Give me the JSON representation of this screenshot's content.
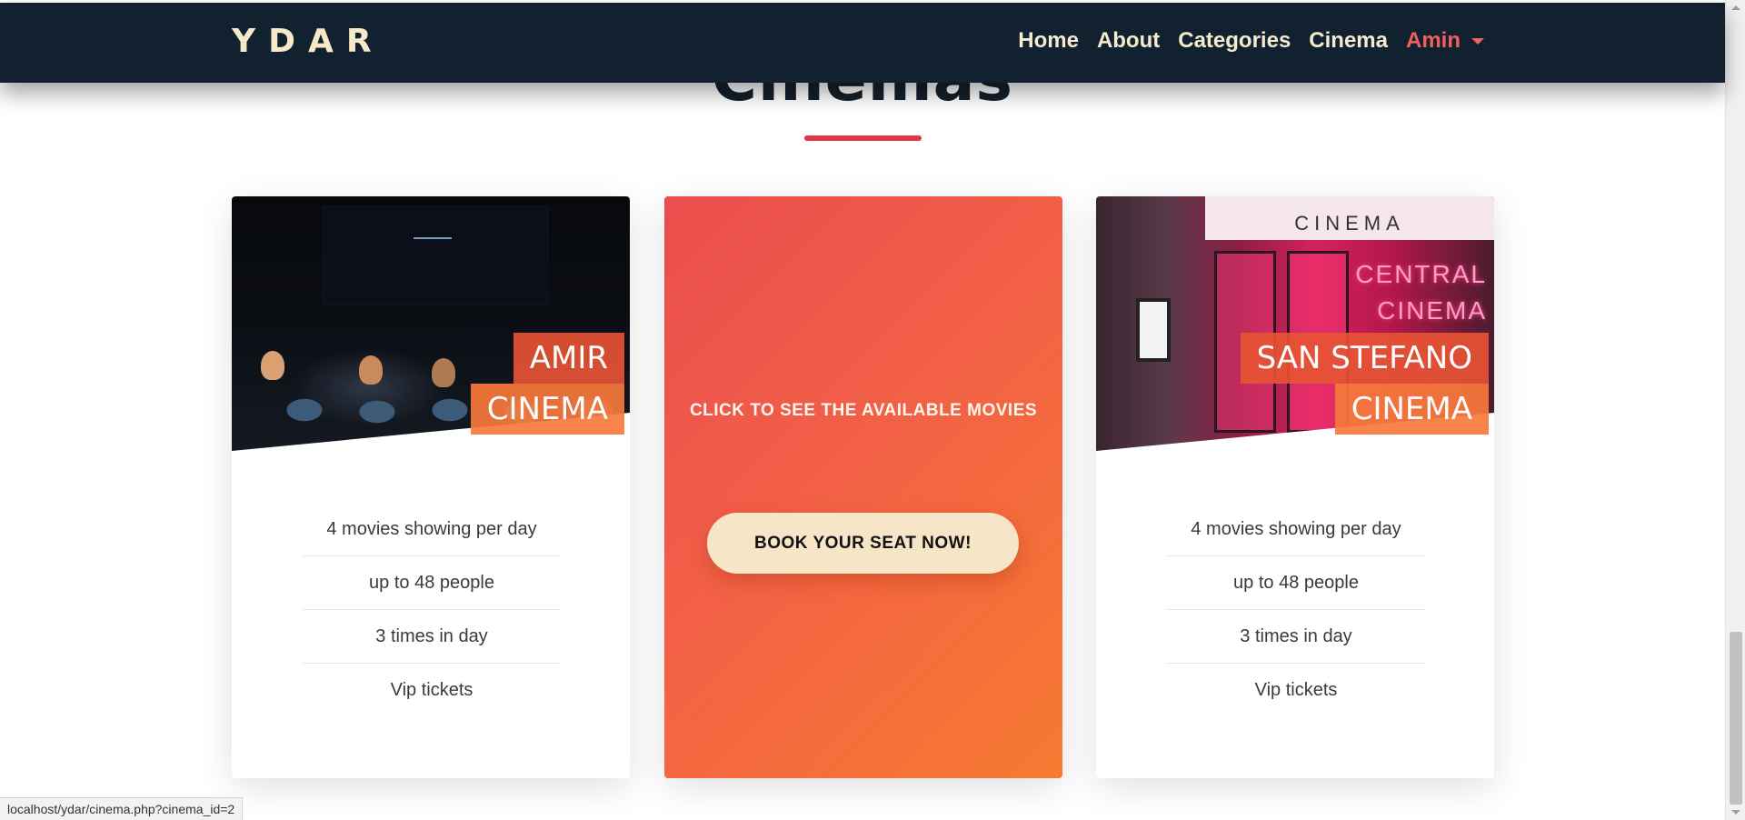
{
  "section": {
    "title": "Cinemas"
  },
  "navbar": {
    "brand": "YDAR",
    "links": [
      "Home",
      "About",
      "Categories",
      "Cinema"
    ],
    "user": "Amin"
  },
  "cards": {
    "left": {
      "name_line1": "AMIR",
      "name_line2": "CINEMA",
      "features": [
        "4 movies showing per day",
        "up to 48 people",
        "3 times in day",
        "Vip tickets"
      ]
    },
    "middle": {
      "caption": "CLICK TO SEE THE AVAILABLE MOVIES",
      "button_label": "BOOK YOUR SEAT NOW!"
    },
    "right": {
      "name_line1": "SAN STEFANO",
      "name_line2": "CINEMA",
      "sign_text": "CINEMA",
      "neon_line1": "CENTRAL",
      "neon_line2": "CINEMA",
      "features": [
        "4 movies showing per day",
        "up to 48 people",
        "3 times in day",
        "Vip tickets"
      ]
    }
  },
  "status_bar": {
    "url": "localhost/ydar/cinema.php?cinema_id=2"
  },
  "colors": {
    "navbar_bg": "#11212f",
    "brand": "#f7e9c8",
    "accent_red": "#e0364b",
    "user_link": "#f06060",
    "gradient_start": "#ea4d4d",
    "gradient_end": "#f77a30",
    "button_bg": "#f6e5c6"
  }
}
